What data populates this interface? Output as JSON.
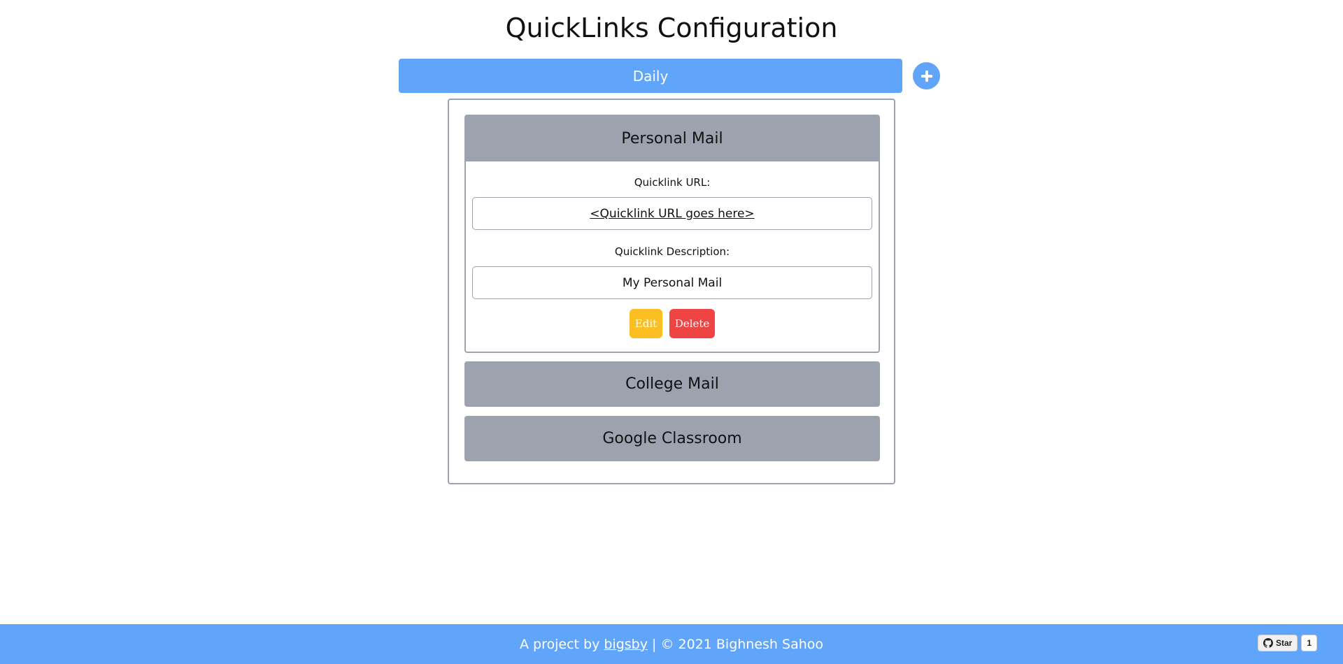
{
  "page": {
    "title": "QuickLinks Configuration"
  },
  "group_tab": {
    "label": "Daily"
  },
  "add_button": {
    "icon": "plus-icon"
  },
  "quicklinks": [
    {
      "title": "Personal Mail",
      "expanded": true,
      "url_label": "Quicklink URL:",
      "url_value": "<Quicklink URL goes here>",
      "description_label": "Quicklink Description:",
      "description_value": "My Personal Mail",
      "edit_label": "Edit",
      "delete_label": "Delete"
    },
    {
      "title": "College Mail",
      "expanded": false
    },
    {
      "title": "Google Classroom",
      "expanded": false
    }
  ],
  "footer": {
    "prefix": "A project by ",
    "link_text": "bigsby",
    "suffix": " | © 2021 Bighnesh Sahoo"
  },
  "github_star": {
    "label": "Star",
    "count": "1",
    "icon": "github-icon"
  },
  "colors": {
    "primary": "#60a5fa",
    "card": "#9ca3af",
    "edit": "#fbbf24",
    "delete": "#ef4444"
  }
}
